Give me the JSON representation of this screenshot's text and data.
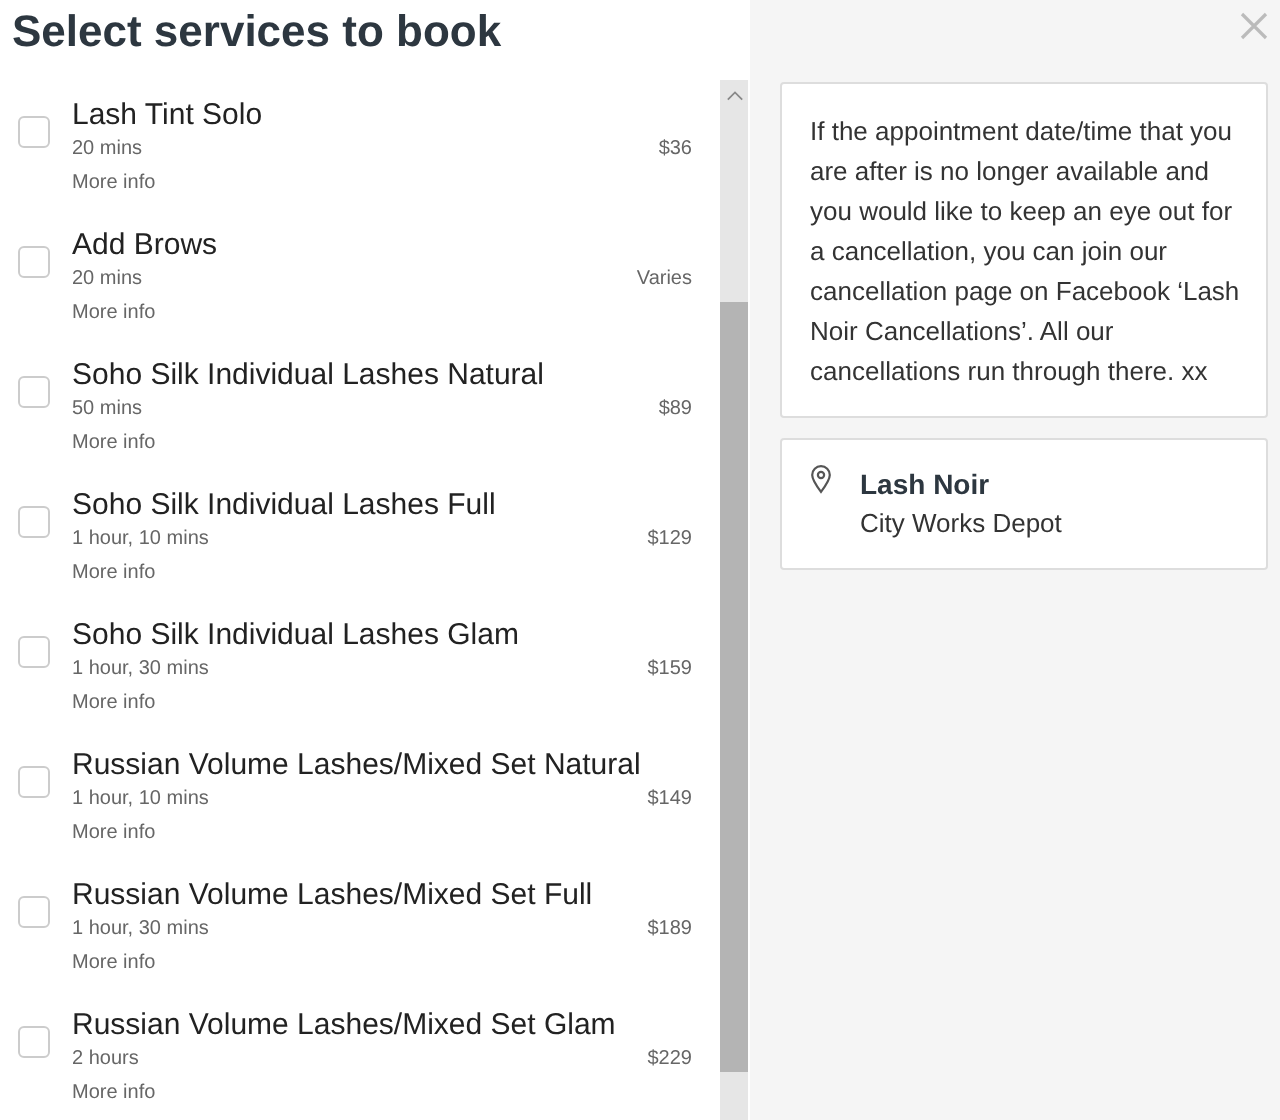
{
  "title": "Select services to book",
  "services": [
    {
      "name": "Lash Tint Solo",
      "duration": "20 mins",
      "price": "$36",
      "more_info": "More info",
      "checked": false
    },
    {
      "name": "Add Brows",
      "duration": "20 mins",
      "price": "Varies",
      "more_info": "More info",
      "checked": false
    },
    {
      "name": "Soho Silk Individual Lashes Natural",
      "duration": "50 mins",
      "price": "$89",
      "more_info": "More info",
      "checked": false
    },
    {
      "name": "Soho Silk Individual Lashes Full",
      "duration": "1 hour, 10 mins",
      "price": "$129",
      "more_info": "More info",
      "checked": false
    },
    {
      "name": "Soho Silk Individual Lashes Glam",
      "duration": "1 hour, 30 mins",
      "price": "$159",
      "more_info": "More info",
      "checked": false
    },
    {
      "name": "Russian Volume Lashes/Mixed Set Natural",
      "duration": "1 hour, 10 mins",
      "price": "$149",
      "more_info": "More info",
      "checked": false
    },
    {
      "name": "Russian Volume Lashes/Mixed Set Full",
      "duration": "1 hour, 30 mins",
      "price": "$189",
      "more_info": "More info",
      "checked": false
    },
    {
      "name": "Russian Volume Lashes/Mixed Set Glam",
      "duration": "2 hours",
      "price": "$229",
      "more_info": "More info",
      "checked": false
    }
  ],
  "notice": "If the appointment date/time that you are after is no longer available and you would like to keep an eye out for a cancellation, you can join our cancellation page on Facebook ‘Lash Noir Cancellations’. All our cancellations run through there. xx",
  "location": {
    "name": "Lash Noir",
    "place": "City Works Depot"
  }
}
